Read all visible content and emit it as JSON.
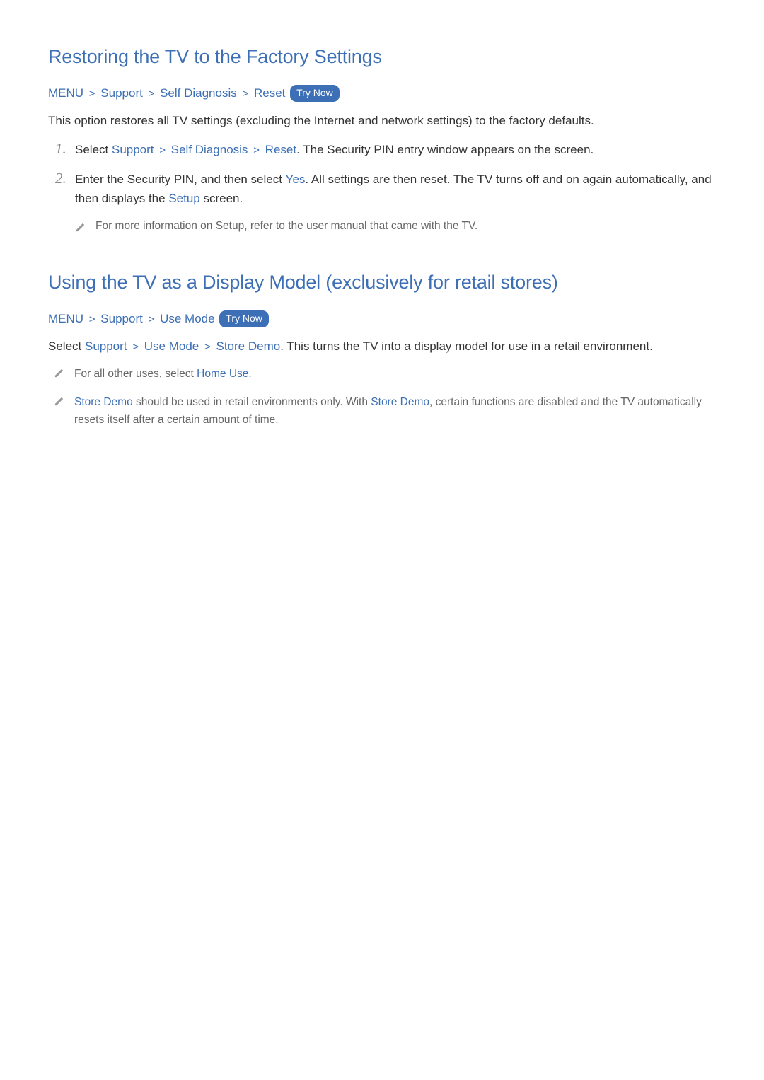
{
  "section1": {
    "heading": "Restoring the TV to the Factory Settings",
    "path": {
      "menu": "MENU",
      "support": "Support",
      "self_diagnosis": "Self Diagnosis",
      "reset": "Reset",
      "try_now": "Try Now"
    },
    "intro": "This option restores all TV settings (excluding the Internet and network settings) to the factory defaults.",
    "steps": {
      "num1": "1.",
      "num2": "2.",
      "s1_a": "Select ",
      "s1_b": "Support",
      "s1_c": "Self Diagnosis",
      "s1_d": "Reset",
      "s1_e": ". The Security PIN entry window appears on the screen.",
      "s2_a": "Enter the Security PIN, and then select ",
      "s2_b": "Yes",
      "s2_c": ". All settings are then reset. The TV turns off and on again automatically, and then displays the ",
      "s2_d": "Setup",
      "s2_e": " screen.",
      "note": "For more information on Setup, refer to the user manual that came with the TV."
    }
  },
  "section2": {
    "heading": "Using the TV as a Display Model (exclusively for retail stores)",
    "path": {
      "menu": "MENU",
      "support": "Support",
      "use_mode": "Use Mode",
      "try_now": "Try Now"
    },
    "intro_a": "Select ",
    "intro_b": "Support",
    "intro_c": "Use Mode",
    "intro_d": "Store Demo",
    "intro_e": ". This turns the TV into a display model for use in a retail environment.",
    "note1_a": "For all other uses, select ",
    "note1_b": "Home Use",
    "note1_c": ".",
    "note2_a": "Store Demo",
    "note2_b": " should be used in retail environments only. With ",
    "note2_c": "Store Demo",
    "note2_d": ", certain functions are disabled and the TV automatically resets itself after a certain amount of time."
  },
  "sep": ">"
}
